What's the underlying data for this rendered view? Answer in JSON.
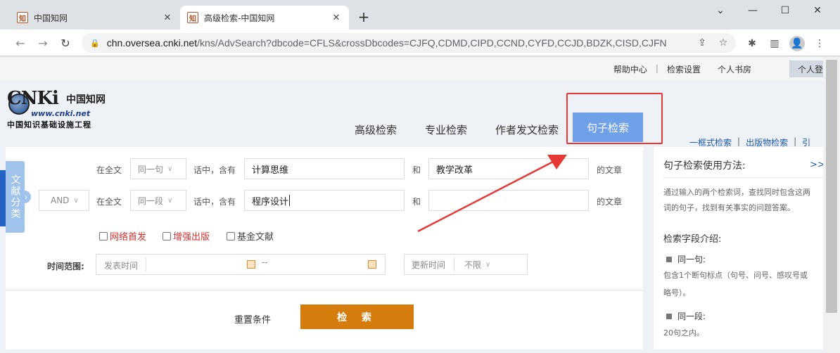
{
  "browser": {
    "tabs": [
      {
        "title": "中国知网",
        "close": "✕"
      },
      {
        "title": "高级检索-中国知网",
        "close": "✕"
      }
    ],
    "new_tab": "+",
    "window_controls": [
      "⌄",
      "—",
      "☐",
      "✕"
    ],
    "url_host": "chn.oversea.cnki.net",
    "url_path": "/kns/AdvSearch?dbcode=CFLS&crossDbcodes=CJFQ,CDMD,CIPD,CCND,CYFD,CCJD,BDZK,CISD,CJFN"
  },
  "topbar": {
    "links": [
      "帮助中心",
      "检索设置",
      "个人书房"
    ],
    "personal": "个人登"
  },
  "logo": {
    "cnki": "CNKi",
    "cn_name": "中国知网",
    "www": "www.cnki.net",
    "slogan": "中国知识基础设施工程"
  },
  "nav": {
    "tabs": [
      "高级检索",
      "专业检索",
      "作者发文检索",
      "句子检索"
    ],
    "active": "句子检索",
    "side_links": [
      "一框式检索",
      "出版物检索",
      "引"
    ]
  },
  "sidetab": "文献分类",
  "form": {
    "row1": {
      "scope": "在全文",
      "unit": "同一句",
      "contains": "话中，含有",
      "term1": "计算思维",
      "and": "和",
      "term2": "教学改革",
      "suffix": "的文章"
    },
    "row2": {
      "logic": "AND",
      "scope": "在全文",
      "unit": "同一段",
      "contains": "话中，含有",
      "term1": "程序设计",
      "and": "和",
      "term2": "",
      "suffix": "的文章"
    },
    "checkboxes": [
      {
        "label": "网络首发",
        "checked": false
      },
      {
        "label": "增强出版",
        "checked": false
      },
      {
        "label": "基金文献",
        "checked": false
      }
    ],
    "time_label": "时间范围:",
    "publish_time": "发表时间",
    "date_sep": "--",
    "update_time": "更新时间",
    "update_value": "不限",
    "reset": "重置条件",
    "search": "检 索"
  },
  "help": {
    "title": "句子检索使用方法:",
    "more": ">>",
    "intro_1": "通过输入的两个检索词，查找同时包含这两",
    "intro_2": "词的句子，找到有关事实的问题答案。",
    "fields_title": "检索字段介绍:",
    "item1_title": "同一句:",
    "item1_desc_1": "包含1个断句标点（句号、问号、感叹号或",
    "item1_desc_2": "略号）。",
    "item2_title": "同一段:",
    "item2_desc": "20句之内。"
  }
}
